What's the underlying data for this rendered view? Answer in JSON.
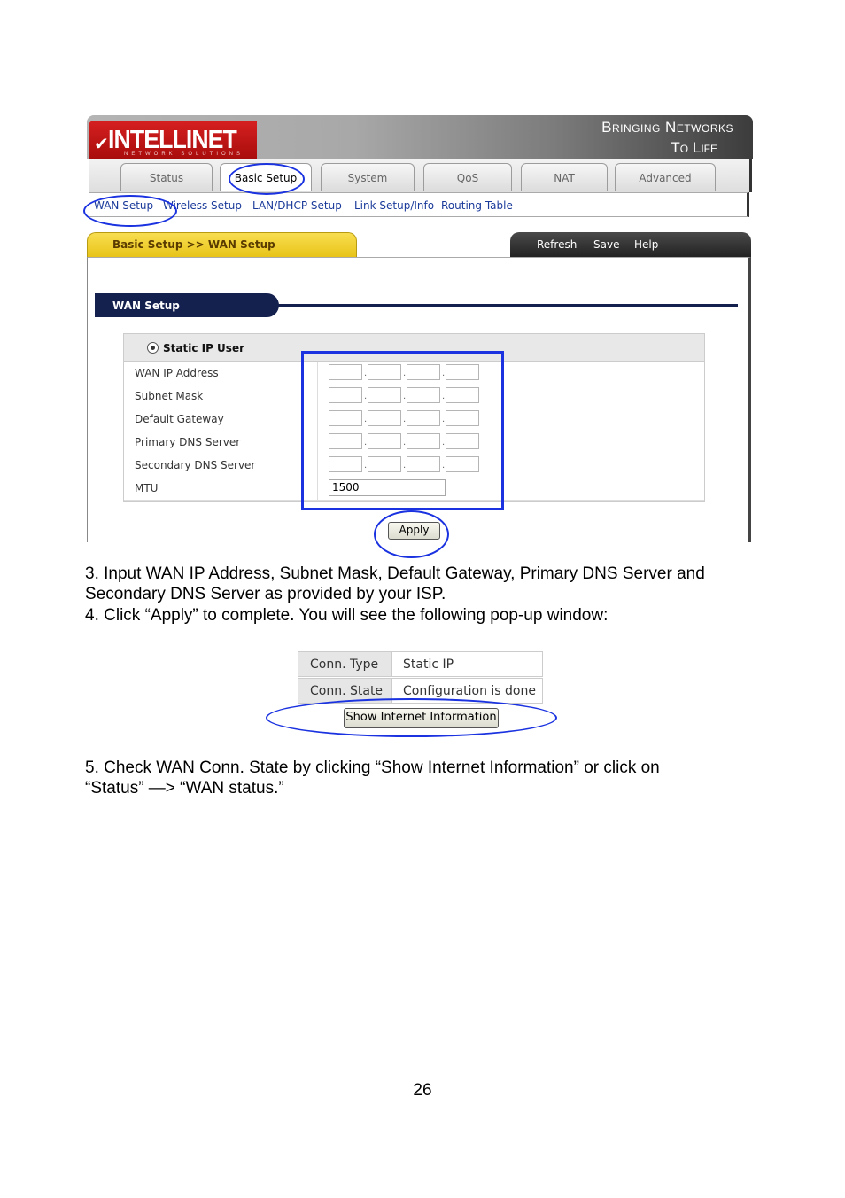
{
  "router_ui": {
    "brand": "INTELLINET",
    "brand_sub": "NETWORK SOLUTIONS",
    "slogan_line1": "Bringing Networks",
    "slogan_line2": "To Life",
    "tabs": [
      {
        "label": "Status"
      },
      {
        "label": "Basic Setup",
        "active": true
      },
      {
        "label": "System"
      },
      {
        "label": "QoS"
      },
      {
        "label": "NAT"
      },
      {
        "label": "Advanced"
      }
    ],
    "subnav": [
      "WAN Setup",
      "Wireless Setup",
      "LAN/DHCP Setup",
      "Link Setup/Info",
      "Routing Table"
    ],
    "breadcrumb": "Basic Setup >> WAN Setup",
    "actions": [
      "Refresh",
      "Save",
      "Help"
    ],
    "section_title": "WAN Setup",
    "form": {
      "mode_label": "Static IP User",
      "rows": [
        {
          "label": "WAN IP Address"
        },
        {
          "label": "Subnet Mask"
        },
        {
          "label": "Default Gateway"
        },
        {
          "label": "Primary DNS Server"
        },
        {
          "label": "Secondary DNS Server"
        }
      ],
      "mtu_label": "MTU",
      "mtu_value": "1500"
    },
    "apply_label": "Apply"
  },
  "instructions": {
    "step3_line1": "3. Input WAN IP Address, Subnet Mask, Default Gateway, Primary DNS Server and",
    "step3_line2": "Secondary DNS Server as provided by your ISP.",
    "step4": "4. Click “Apply” to complete. You will see the following pop-up window:",
    "step5_line1": "5. Check WAN Conn. State by clicking “Show Internet Information” or click on",
    "step5_line2": "“Status” —> “WAN status.”"
  },
  "popup": {
    "rows": [
      {
        "key": "Conn. Type",
        "value": "Static IP"
      },
      {
        "key": "Conn. State",
        "value": "Configuration is done"
      }
    ],
    "button_label": "Show Internet Information"
  },
  "page_number": "26",
  "colors": {
    "annotation": "#1a32e0",
    "brand_red": "#c81414",
    "header_navy": "#14204e",
    "breadcrumb_yellow": "#f0cf30"
  }
}
